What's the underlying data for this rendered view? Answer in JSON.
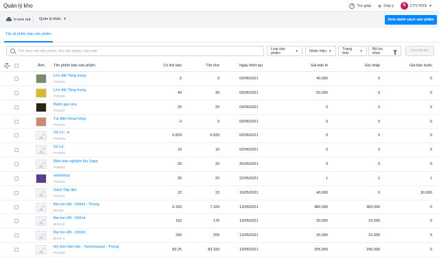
{
  "header": {
    "title": "Quản lý kho",
    "help_label": "Trợ giúp",
    "feedback_label": "Góp ý",
    "avatar_initial": "S",
    "user_name": "CTV POS"
  },
  "toolbar": {
    "print_label": "In tem mã",
    "manage_label": "Quản lý khác",
    "primary_button": "Xem danh sách sản phẩm"
  },
  "tabs": [
    {
      "label": "Tất cả phiên bản sản phẩm",
      "active": true
    }
  ],
  "filters": {
    "search_placeholder": "Tìm theo mã sản phẩm, tên sản phẩm, barcode",
    "product_type": "Loại sản phẩm",
    "brand": "Nhãn hiệu",
    "status": "Trạng thái",
    "other_filters": "Bộ lọc khác",
    "save_filter": "Lưu bộ lọc"
  },
  "table": {
    "columns": {
      "image": "Ảnh",
      "name": "Tên phiên bản sản phẩm",
      "available": "Có thể bán",
      "inventory": "Tồn kho",
      "created": "Ngày khởi tạo",
      "retail": "Giá bán lẻ",
      "import": "Giá nhập",
      "wholesale": "Giá bán buôn"
    },
    "rows": [
      {
        "name": "Lớn đất Tăng trọng",
        "sku": "PVN200",
        "available": "-2",
        "inventory": "0",
        "created": "03/06/2021",
        "retail": "40,000",
        "import": "0",
        "wholesale": "0",
        "thumb": "product-photo",
        "thumb_color": "#7a8a6a"
      },
      {
        "name": "Lớn đất Tăng trọng",
        "sku": "PVN208",
        "available": "40",
        "inventory": "43",
        "created": "03/06/2021",
        "retail": "50,000",
        "import": "0",
        "wholesale": "0",
        "thumb": "product-photo",
        "thumb_color": "#d8b92c"
      },
      {
        "name": "Bánh gạo one",
        "sku": "PVN207",
        "available": "20",
        "inventory": "20",
        "created": "03/06/2021",
        "retail": "0",
        "import": "0",
        "wholesale": "0",
        "thumb": "product-photo",
        "thumb_color": "#2a2418"
      },
      {
        "name": "Túi điện thoại hồng",
        "sku": "PVN206",
        "available": "-2",
        "inventory": "0",
        "created": "03/06/2021",
        "retail": "0",
        "import": "0",
        "wholesale": "0",
        "thumb": "product-photo",
        "thumb_color": "#c98a72"
      },
      {
        "name": "Số Lô - vl",
        "sku": "PVN205",
        "available": "0.833",
        "inventory": "0.833",
        "created": "02/06/2021",
        "retail": "0",
        "import": "0",
        "wholesale": "0",
        "thumb": "placeholder",
        "thumb_color": "#f1f3f5"
      },
      {
        "name": "Số Lô",
        "sku": "PVN204",
        "available": "10",
        "inventory": "10",
        "created": "02/06/2021",
        "retail": "0",
        "import": "0",
        "wholesale": "0",
        "thumb": "placeholder",
        "thumb_color": "#f1f3f5"
      },
      {
        "name": "Biên bản nghiệm thu Sapo",
        "sku": "PVN203",
        "available": "20",
        "inventory": "20",
        "created": "25/05/2021",
        "retail": "0",
        "import": "0",
        "wholesale": "0",
        "thumb": "placeholder",
        "thumb_color": "#f1f3f5"
      },
      {
        "name": "workshop",
        "sku": "PVN202",
        "available": "20",
        "inventory": "20",
        "created": "22/05/2021",
        "retail": "1",
        "import": "1",
        "wholesale": "1",
        "thumb": "product-photo",
        "thumb_color": "#5b3d8f"
      },
      {
        "name": "Sách Tập đọc",
        "sku": "PVN201",
        "available": "22",
        "inventory": "23",
        "created": "19/05/2021",
        "retail": "40,000",
        "import": "0",
        "wholesale": "30,000",
        "thumb": "placeholder",
        "thumb_color": "#f1f3f5"
      },
      {
        "name": "Bia lon HN - 500ml - Thùng",
        "sku": "BIA002",
        "available": "6.333",
        "inventory": "7.333",
        "created": "13/05/2021",
        "retail": "480,000",
        "import": "360,000",
        "wholesale": "0",
        "thumb": "placeholder",
        "thumb_color": "#f1f3f5"
      },
      {
        "name": "Bia lon HN - 500ml",
        "sku": "BIA01-5",
        "available": "152",
        "inventory": "176",
        "created": "13/05/2021",
        "retail": "20,000",
        "import": "15,000",
        "wholesale": "0",
        "thumb": "placeholder",
        "thumb_color": "#f1f3f5"
      },
      {
        "name": "Bia lon HN - 330ml",
        "sku": "BIA01-3",
        "available": "200",
        "inventory": "200",
        "created": "13/05/2021",
        "retail": "20,000",
        "import": "15,000",
        "wholesale": "0",
        "thumb": "placeholder",
        "thumb_color": "#f1f3f5"
      },
      {
        "name": "Mỳ tôm hảo hảo - Tomchuacay - Thùng",
        "sku": "PVN200",
        "available": "83.25",
        "inventory": "83.333",
        "created": "13/05/2021",
        "retail": "205,000",
        "import": "240,000",
        "wholesale": "0",
        "thumb": "placeholder",
        "thumb_color": "#f1f3f5"
      }
    ]
  }
}
